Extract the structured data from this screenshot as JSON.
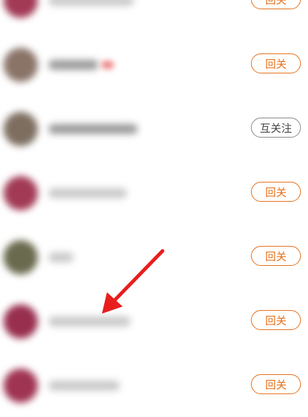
{
  "rows": [
    {
      "action_label": "回关",
      "action_style": "orange",
      "avatar_color": "#a23a55",
      "name_width": 120,
      "name_tone": "light"
    },
    {
      "action_label": "回关",
      "action_style": "orange",
      "avatar_color": "#8a7468",
      "name_width": 70,
      "name_tone": "dark",
      "has_pink": true
    },
    {
      "action_label": "互关注",
      "action_style": "gray",
      "avatar_color": "#7d6e60",
      "name_width": 125,
      "name_tone": "dark"
    },
    {
      "action_label": "回关",
      "action_style": "orange",
      "avatar_color": "#a23a55",
      "name_width": 110,
      "name_tone": "light"
    },
    {
      "action_label": "回关",
      "action_style": "orange",
      "avatar_color": "#6a6a4f",
      "name_width": 35,
      "name_tone": "light"
    },
    {
      "action_label": "回关",
      "action_style": "orange",
      "avatar_color": "#982f4f",
      "name_width": 115,
      "name_tone": "light"
    },
    {
      "action_label": "回关",
      "action_style": "orange",
      "avatar_color": "#9f3352",
      "name_width": 100,
      "name_tone": "light"
    }
  ],
  "colors": {
    "accent": "#e6701a",
    "arrow": "#e81e1e"
  }
}
